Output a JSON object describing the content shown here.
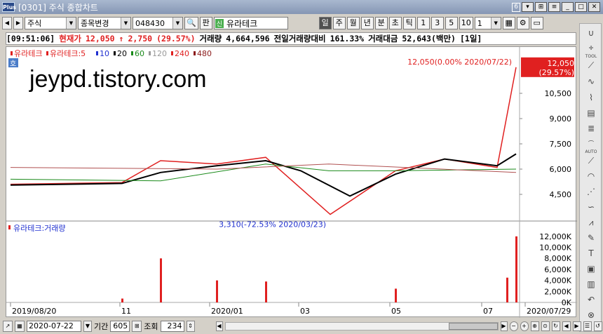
{
  "window": {
    "title": "[0301] 주식 종합차트",
    "app_icon_text": "Plus",
    "window_number": "6"
  },
  "toolbar": {
    "market": "주식",
    "stock_change": "종목변경",
    "code": "048430",
    "pan_label": "판",
    "new_badge": "신",
    "stock_name": "유라테크",
    "period_buttons": [
      "일",
      "주",
      "월",
      "년",
      "분",
      "초",
      "틱"
    ],
    "active_period": "일",
    "interval_buttons": [
      "1",
      "3",
      "5",
      "10"
    ],
    "interval_value": "1"
  },
  "infobar": {
    "time": "[09:51:06]",
    "price_label": "현재가",
    "price": "12,050",
    "arrow": "↑",
    "change": "2,750",
    "change_pct": "(29.57%)",
    "volume_label": "거래량",
    "volume": "4,664,596",
    "prev_ratio_label": "전일거래량대비",
    "prev_ratio": "161.33%",
    "amount_label": "거래대금",
    "amount": "52,643(백만)",
    "period": "[1일]"
  },
  "price_panel": {
    "legend": [
      {
        "label": "유라테크",
        "color": "#e02020"
      },
      {
        "label": "유라테크:5",
        "color": "#e02020"
      },
      {
        "label": "10",
        "color": "#2030d0"
      },
      {
        "label": "20",
        "color": "#000000"
      },
      {
        "label": "60",
        "color": "#1a8a1a"
      },
      {
        "label": "120",
        "color": "#999999"
      },
      {
        "label": "240",
        "color": "#e02020"
      },
      {
        "label": "480",
        "color": "#8b1a1a"
      }
    ],
    "ho_label": "호",
    "watermark": "jeypd.tistory.com",
    "high_annotation": "12,050(0.00% 2020/07/22)",
    "low_annotation": "3,310(-72.53% 2020/03/23)",
    "last_price": "12,050",
    "last_pct": "(29.57%)",
    "y_ticks": [
      "10,500",
      "9,000",
      "7,500",
      "6,000",
      "4,500"
    ]
  },
  "volume_panel": {
    "legend": "유라테크:거래량",
    "y_ticks": [
      "12,000K",
      "10,000K",
      "8,000K",
      "6,000K",
      "4,000K",
      "2,000K",
      "0K"
    ]
  },
  "x_axis": {
    "labels": [
      "2019/08/20",
      "11",
      "2020/01",
      "03",
      "05",
      "07",
      "2020/07/29"
    ]
  },
  "bottom": {
    "date": "2020-07-22",
    "period_label": "기간",
    "period_value": "605",
    "lookup_label": "조회",
    "lookup_value": "234"
  },
  "right_tools": [
    "TOOL",
    "AUTO"
  ],
  "chart_data": {
    "type": "candlestick",
    "price_series_key_points": [
      {
        "x": "2019/08/20",
        "y": 5100
      },
      {
        "x": "2019/11",
        "y": 5200
      },
      {
        "x": "2019/12",
        "y": 6500
      },
      {
        "x": "2020/01",
        "y": 6300
      },
      {
        "x": "2020/02",
        "y": 6700
      },
      {
        "x": "2020/03/23",
        "y": 3310
      },
      {
        "x": "2020/05",
        "y": 5900
      },
      {
        "x": "2020/06",
        "y": 6600
      },
      {
        "x": "2020/07/10",
        "y": 6100
      },
      {
        "x": "2020/07/22",
        "y": 12050
      }
    ],
    "volume_key_points": [
      {
        "x": "2019/11",
        "y": 700
      },
      {
        "x": "2019/12",
        "y": 8000
      },
      {
        "x": "2020/01",
        "y": 4000
      },
      {
        "x": "2020/02",
        "y": 3800
      },
      {
        "x": "2020/05",
        "y": 2500
      },
      {
        "x": "2020/07/20",
        "y": 4500
      },
      {
        "x": "2020/07/22",
        "y": 12000
      }
    ],
    "y_range_price": [
      3000,
      12500
    ],
    "y_range_volume": [
      0,
      13000
    ]
  }
}
